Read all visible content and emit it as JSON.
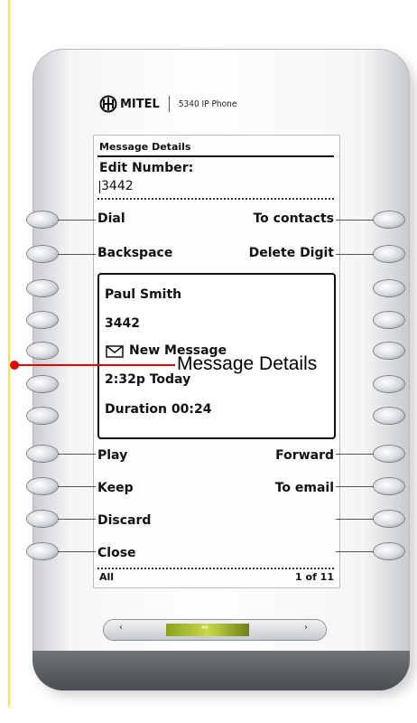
{
  "brand": {
    "name": "MITEL",
    "model": "5340 IP Phone"
  },
  "screen": {
    "header": "Message Details",
    "edit_label": "Edit Number:",
    "edit_value": "3442",
    "softkeys_left": [
      "Dial",
      "Backspace"
    ],
    "softkeys_right": [
      "To contacts",
      "Delete Digit"
    ],
    "message": {
      "name": "Paul Smith",
      "number": "3442",
      "status": "New Message",
      "time": "2:32p Today",
      "duration": "Duration 00:24"
    },
    "actions_left": [
      "Play",
      "Keep",
      "Discard",
      "Close"
    ],
    "actions_right": [
      "Forward",
      "To email"
    ],
    "footer_left": "All",
    "footer_right": "1 of 11"
  },
  "callout": {
    "label": "Message Details",
    "color": "#e10600"
  },
  "colors": {
    "nav_accent": "#a8bd2e",
    "frame_dark": "#4a4d51"
  }
}
